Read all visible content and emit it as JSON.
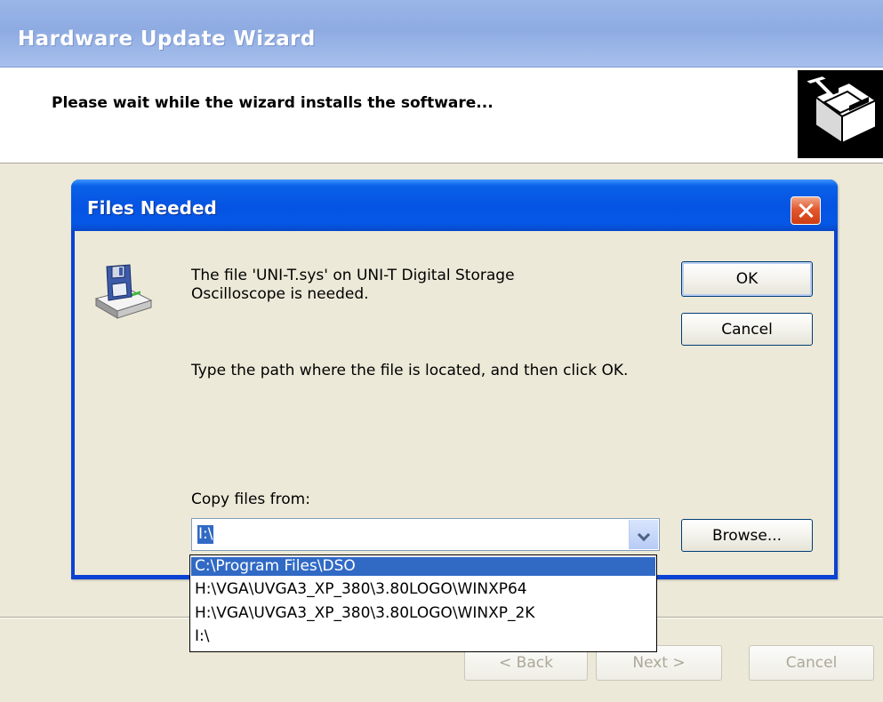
{
  "wizard": {
    "title": "Hardware Update Wizard",
    "heading": "Please wait while the wizard installs the software...",
    "buttons": {
      "back": "< Back",
      "next": "Next >",
      "cancel": "Cancel"
    }
  },
  "dialog": {
    "title": "Files Needed",
    "message1": "The file 'UNI-T.sys' on UNI-T Digital Storage Oscilloscope is needed.",
    "message2": "Type the path where the file is located, and then click OK.",
    "copy_label": "Copy files from:",
    "copy_value": "I:\\",
    "buttons": {
      "ok": "OK",
      "cancel": "Cancel",
      "browse": "Browse..."
    },
    "dropdown_items": [
      "C:\\Program Files\\DSO",
      "H:\\VGA\\UVGA3_XP_380\\3.80LOGO\\WINXP64",
      "H:\\VGA\\UVGA3_XP_380\\3.80LOGO\\WINXP_2K",
      "I:\\"
    ],
    "selected_index": 0
  },
  "icons": {
    "wizard_logo": "hardware-install-icon",
    "dialog_icon": "floppy-disk-drive-icon",
    "close": "close-icon",
    "dropdown_arrow": "chevron-down-icon"
  },
  "colors": {
    "titlebar_blue": "#0554e3",
    "selection_blue": "#316ac5",
    "window_face": "#ece9d8",
    "close_red": "#e2582e"
  }
}
